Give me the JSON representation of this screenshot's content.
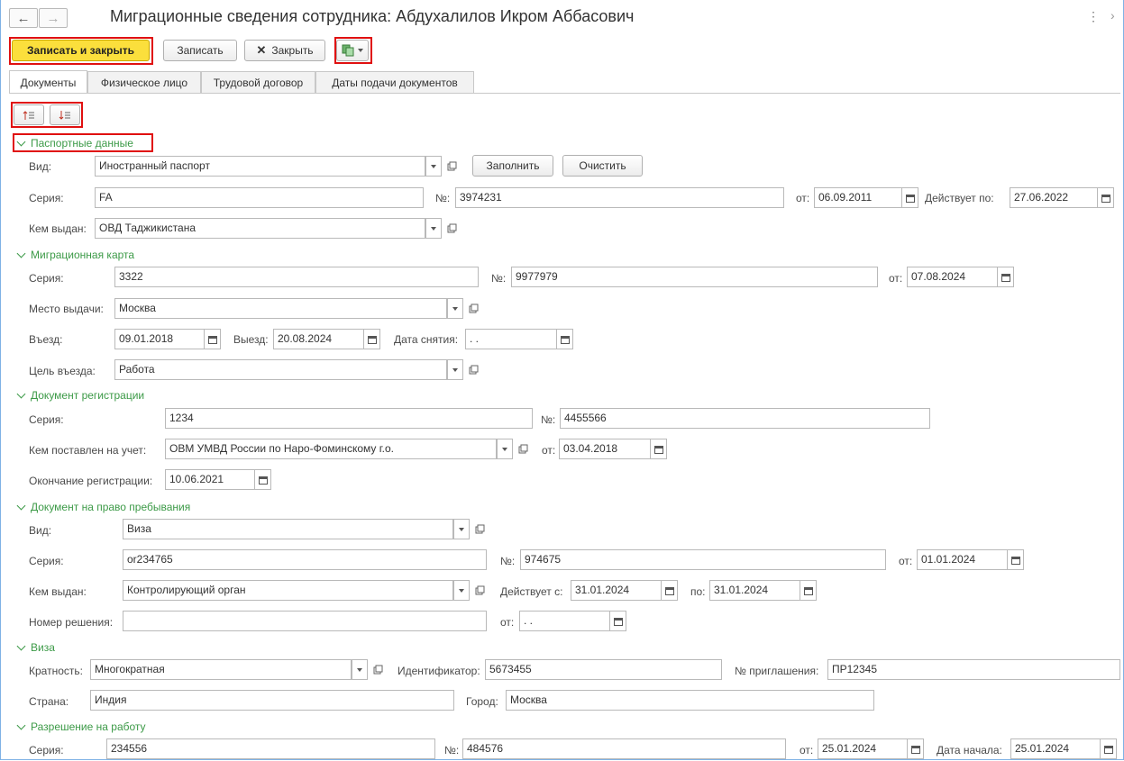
{
  "window": {
    "title": "Миграционные сведения сотрудника: Абдухалилов Икром Аббасович",
    "menu_icon": "⋮",
    "expand_icon": "›"
  },
  "nav": {
    "back_icon": "←",
    "forward_icon": "→"
  },
  "toolbar": {
    "save_close": "Записать и закрыть",
    "save": "Записать",
    "close": "Закрыть",
    "close_icon": "✕"
  },
  "tabs": [
    "Документы",
    "Физическое лицо",
    "Трудовой договор",
    "Даты подачи документов"
  ],
  "sections": {
    "passport": {
      "title": "Паспортные данные",
      "type_label": "Вид:",
      "type_value": "Иностранный паспорт",
      "fill": "Заполнить",
      "clear": "Очистить",
      "series_label": "Серия:",
      "series_value": "FA",
      "number_label": "№:",
      "number_value": "3974231",
      "from_label": "от:",
      "from_value": "06.09.2011",
      "valid_label": "Действует по:",
      "valid_value": "27.06.2022",
      "issued_label": "Кем выдан:",
      "issued_value": "ОВД Таджикистана"
    },
    "migration_card": {
      "title": "Миграционная карта",
      "series_label": "Серия:",
      "series_value": "3322",
      "number_label": "№:",
      "number_value": "9977979",
      "from_label": "от:",
      "from_value": "07.08.2024",
      "place_label": "Место выдачи:",
      "place_value": "Москва",
      "entry_label": "Въезд:",
      "entry_value": "09.01.2018",
      "exit_label": "Выезд:",
      "exit_value": "20.08.2024",
      "removal_label": "Дата снятия:",
      "removal_value": " .  .",
      "purpose_label": "Цель въезда:",
      "purpose_value": "Работа"
    },
    "registration": {
      "title": "Документ регистрации",
      "series_label": "Серия:",
      "series_value": "1234",
      "number_label": "№:",
      "number_value": "4455566",
      "by_label": "Кем поставлен на учет:",
      "by_value": "ОВМ УМВД России по Наро-Фоминскому г.о.",
      "from_label": "от:",
      "from_value": "03.04.2018",
      "end_label": "Окончание регистрации:",
      "end_value": "10.06.2021"
    },
    "stay": {
      "title": "Документ на право пребывания",
      "type_label": "Вид:",
      "type_value": "Виза",
      "series_label": "Серия:",
      "series_value": "or234765",
      "number_label": "№:",
      "number_value": "974675",
      "from_label": "от:",
      "from_value": "01.01.2024",
      "issued_label": "Кем выдан:",
      "issued_value": "Контролирующий орган",
      "valid_from_label": "Действует с:",
      "valid_from_value": "31.01.2024",
      "to_label": "по:",
      "to_value": "31.01.2024",
      "decision_label": "Номер решения:",
      "decision_value": "",
      "decision_from_label": "от:",
      "decision_from_value": " .  ."
    },
    "visa": {
      "title": "Виза",
      "multiplicity_label": "Кратность:",
      "multiplicity_value": "Многократная",
      "id_label": "Идентификатор:",
      "id_value": "5673455",
      "invite_label": "№ приглашения:",
      "invite_value": "ПР12345",
      "country_label": "Страна:",
      "country_value": "Индия",
      "city_label": "Город:",
      "city_value": "Москва"
    },
    "work_permit": {
      "title": "Разрешение на работу",
      "series_label": "Серия:",
      "series_value": "234556",
      "number_label": "№:",
      "number_value": "484576",
      "from_label": "от:",
      "from_value": "25.01.2024",
      "start_label": "Дата начала:",
      "start_value": "25.01.2024"
    }
  },
  "colors": {
    "accent_green": "#3c9a47",
    "primary_yellow": "#fbdf3c",
    "highlight_red": "#e01010"
  }
}
